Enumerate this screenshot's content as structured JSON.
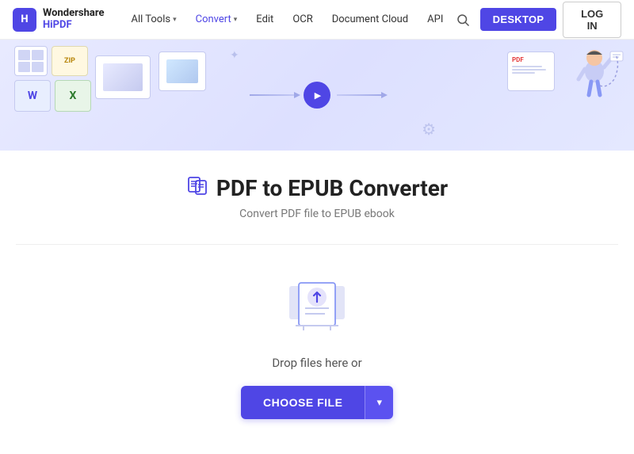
{
  "brand": {
    "logo_text_line1": "Wondershare",
    "logo_text_line2": "HiPDF",
    "logo_letter": "H"
  },
  "navbar": {
    "items": [
      {
        "label": "All Tools",
        "has_dropdown": true
      },
      {
        "label": "Convert",
        "has_dropdown": true,
        "active": true
      },
      {
        "label": "Edit",
        "has_dropdown": false
      },
      {
        "label": "OCR",
        "has_dropdown": false
      },
      {
        "label": "Document Cloud",
        "has_dropdown": false
      },
      {
        "label": "API",
        "has_dropdown": false
      }
    ],
    "desktop_btn": "DESKTOP",
    "login_btn": "LOG IN"
  },
  "hero": {
    "doc_zip": "ZIP",
    "doc_w": "W",
    "doc_x": "X",
    "doc_pdf": "PDF"
  },
  "page": {
    "title": "PDF to EPUB Converter",
    "subtitle": "Convert PDF file to EPUB ebook"
  },
  "dropzone": {
    "drop_text": "Drop files here or",
    "choose_btn": "CHOOSE FILE",
    "dropdown_icon": "▾"
  }
}
